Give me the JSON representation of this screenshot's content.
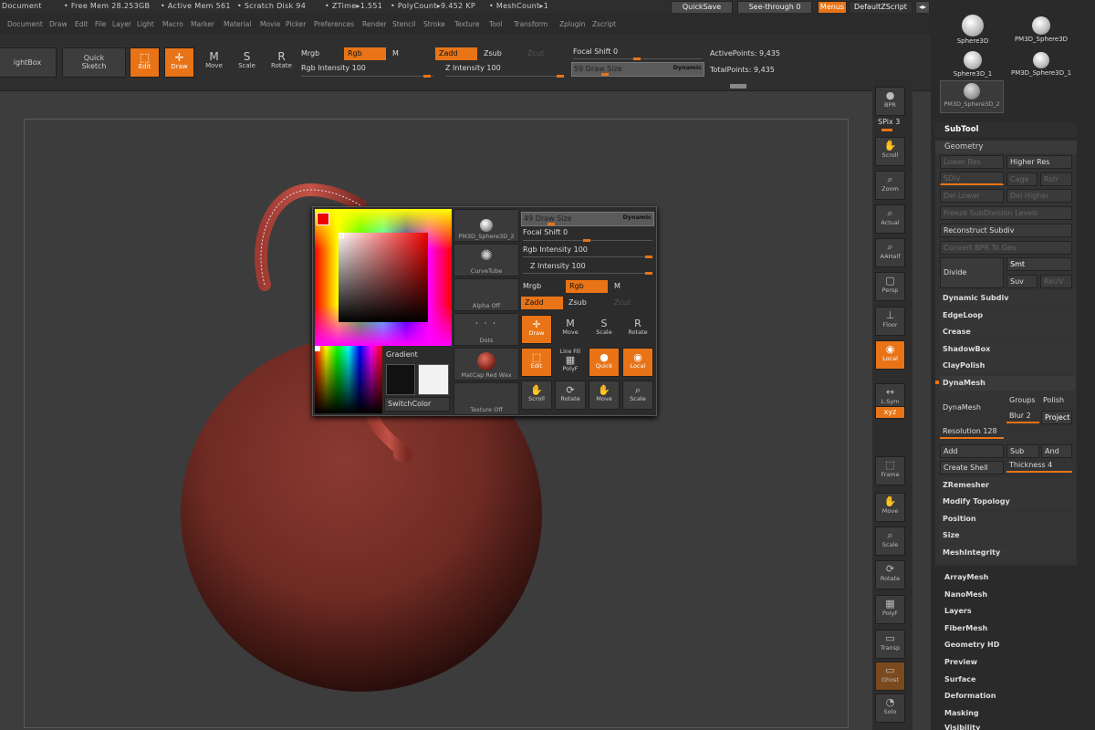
{
  "status": {
    "document": "Document",
    "free_mem": "• Free Mem 28.253GB",
    "active_mem": "• Active Mem 561",
    "scratch": "• Scratch Disk 94",
    "ztime": "• ZTime▸1.551",
    "polycount": "• PolyCount▸9.452 KP",
    "meshcount": "• MeshCount▸1"
  },
  "top_buttons": {
    "quicksave": "QuickSave",
    "see_through": "See-through   0",
    "menus": "Menus",
    "default_zscript": "DefaultZScript"
  },
  "menus": [
    "Document",
    "Draw",
    "Edit",
    "File",
    "Layer",
    "Light",
    "Macro",
    "Marker",
    "Material",
    "Movie",
    "Picker",
    "Preferences",
    "Render",
    "Stencil",
    "Stroke",
    "Texture",
    "Tool",
    "Transform",
    "Zplugin",
    "Zscript"
  ],
  "shelf": {
    "lightbox": "ightBox",
    "quick_sketch": "Quick\nSketch",
    "edit": "Edit",
    "draw": "Draw",
    "move": "Move",
    "scale": "Scale",
    "rotate": "Rotate",
    "mrgb": "Mrgb",
    "rgb": "Rgb",
    "m": "M",
    "zadd": "Zadd",
    "zsub": "Zsub",
    "zcut": "Zcut",
    "rgb_intensity": "Rgb Intensity 100",
    "z_intensity": "Z Intensity 100",
    "focal_shift": "Focal Shift 0",
    "draw_size": "59 Draw Size",
    "dynamic": "Dynamic",
    "active_points": "ActivePoints: 9,435",
    "total_points": "TotalPoints: 9,435"
  },
  "vshelf": [
    "BPR",
    "SPix 3",
    "Scroll",
    "Zoom",
    "Actual",
    "AAHalf",
    "Persp",
    "Floor",
    "Local",
    "L.Sym",
    "Xyz",
    "Frame",
    "Move",
    "Scale",
    "Rotate",
    "PolyF",
    "Transp",
    "Ghost",
    "Solo"
  ],
  "vshelf_extra": {
    "dynamic": "Dynamic",
    "linefill": "Line Fill",
    "spix_val": "SPix 3"
  },
  "right_panel": {
    "tools": [
      "Sphere3D",
      "PM3D_Sphere3D",
      "Sphere3D_1",
      "PM3D_Sphere3D_1",
      "PM3D_Sphere3D_2"
    ],
    "subtool": "SubTool",
    "geometry": "Geometry",
    "lower_res": "Lower Res",
    "higher_res": "Higher Res",
    "sdiv": "SDiv",
    "cage": "Cage",
    "rstr": "Rstr",
    "del_lower": "Del Lower",
    "del_higher": "Del Higher",
    "freeze": "Freeze SubDivision Levels",
    "reconstruct": "Reconstruct Subdiv",
    "convert_bpr": "Convert BPR To Geo",
    "divide": "Divide",
    "smt": "Smt",
    "suv": "Suv",
    "reuv": "ReUV",
    "items": [
      "Dynamic Subdiv",
      "EdgeLoop",
      "Crease",
      "ShadowBox",
      "ClayPolish"
    ],
    "dynamesh": "DynaMesh",
    "dynamesh_btn": "DynaMesh",
    "groups": "Groups",
    "polish": "Polish",
    "blur": "Blur 2",
    "project": "Project",
    "resolution": "Resolution 128",
    "add": "Add",
    "sub": "Sub",
    "and": "And",
    "create_shell": "Create Shell",
    "thickness": "Thickness 4",
    "items2": [
      "ZRemesher",
      "Modify Topology",
      "Position",
      "Size",
      "MeshIntegrity"
    ],
    "sections": [
      "ArrayMesh",
      "NanoMesh",
      "Layers",
      "FiberMesh",
      "Geometry HD",
      "Preview",
      "Surface",
      "Deformation",
      "Masking",
      "Visibility"
    ]
  },
  "popup": {
    "gradient": "Gradient",
    "switch_color": "SwitchColor",
    "thumbs": [
      "PM3D_Sphere3D_2",
      "CurveTube",
      "Alpha Off",
      "Dots",
      "MatCap Red Wax",
      "Texture Off"
    ],
    "draw_size": "49 Draw Size",
    "dynamic": "Dynamic",
    "focal_shift": "Focal Shift 0",
    "rgb_intensity": "Rgb Intensity 100",
    "z_intensity": "Z Intensity 100",
    "mrgb": "Mrgb",
    "rgb": "Rgb",
    "m": "M",
    "zadd": "Zadd",
    "zsub": "Zsub",
    "zcut": "Zcut",
    "buttons": [
      "Draw",
      "Move",
      "Scale",
      "Rotate",
      "Edit",
      "PolyF",
      "Quick",
      "Local",
      "Scroll",
      "Rotate",
      "Move",
      "Scale"
    ],
    "linefill": "Line Fill"
  },
  "colors": {
    "accent": "#e87417",
    "model": "#7a2a24"
  }
}
